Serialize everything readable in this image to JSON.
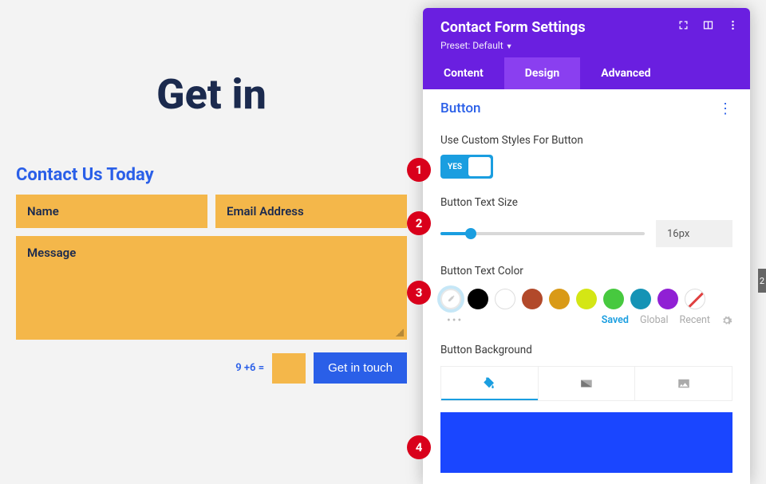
{
  "page": {
    "title": "Get in",
    "form_title": "Contact Us Today",
    "name_label": "Name",
    "email_label": "Email Address",
    "message_label": "Message",
    "captcha_q": "9 +6 =",
    "submit_label": "Get in touch"
  },
  "annotations": {
    "n1": "1",
    "n2": "2",
    "n3": "3",
    "n4": "4"
  },
  "panel": {
    "title": "Contact Form Settings",
    "preset_label": "Preset: Default",
    "tabs": {
      "content": "Content",
      "design": "Design",
      "advanced": "Advanced"
    },
    "section": "Button",
    "custom_styles_label": "Use Custom Styles For Button",
    "toggle_yes": "YES",
    "text_size_label": "Button Text Size",
    "text_size_value": "16px",
    "text_color_label": "Button Text Color",
    "palette": {
      "saved": "Saved",
      "global": "Global",
      "recent": "Recent"
    },
    "bg_label": "Button Background",
    "colors": {
      "black": "#000000",
      "white": "#ffffff",
      "redbrown": "#b2492a",
      "amber": "#d99a17",
      "lime": "#d4e615",
      "green": "#47c93f",
      "teal": "#1593b5",
      "purple": "#9020d4",
      "bg_preview": "#1a46ff"
    }
  },
  "side_marker": "2"
}
